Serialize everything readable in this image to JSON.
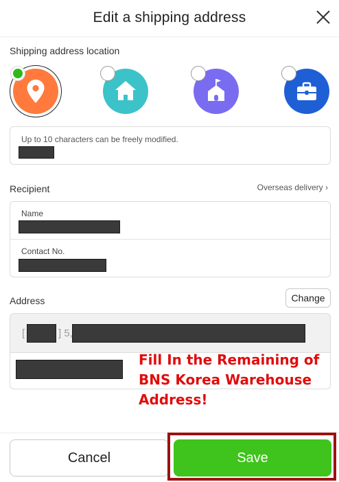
{
  "header": {
    "title": "Edit a shipping address",
    "close_icon": "close-icon"
  },
  "location": {
    "label": "Shipping address location",
    "options": [
      {
        "icon": "map-pin-icon",
        "color": "#ff7a3c",
        "selected": true
      },
      {
        "icon": "house-icon",
        "color": "#3cc2c9",
        "selected": false
      },
      {
        "icon": "school-icon",
        "color": "#7a6cf0",
        "selected": false
      },
      {
        "icon": "briefcase-icon",
        "color": "#1f5fd6",
        "selected": false
      }
    ],
    "nickname_hint": "Up to 10 characters can be freely modified."
  },
  "recipient": {
    "label": "Recipient",
    "overseas_link": "Overseas delivery",
    "name_label": "Name",
    "contact_label": "Contact No."
  },
  "address": {
    "label": "Address",
    "change_button": "Change",
    "prefix_open": "[",
    "prefix_close": "] 5,"
  },
  "annotation": {
    "text_line1": "Fill In the Remaining of",
    "text_line2": "BNS Korea Warehouse",
    "text_line3": "Address!",
    "color": "#e00d0d"
  },
  "footer": {
    "cancel_label": "Cancel",
    "save_label": "Save",
    "save_color": "#3fc31d",
    "highlight_color": "#9b1111"
  }
}
